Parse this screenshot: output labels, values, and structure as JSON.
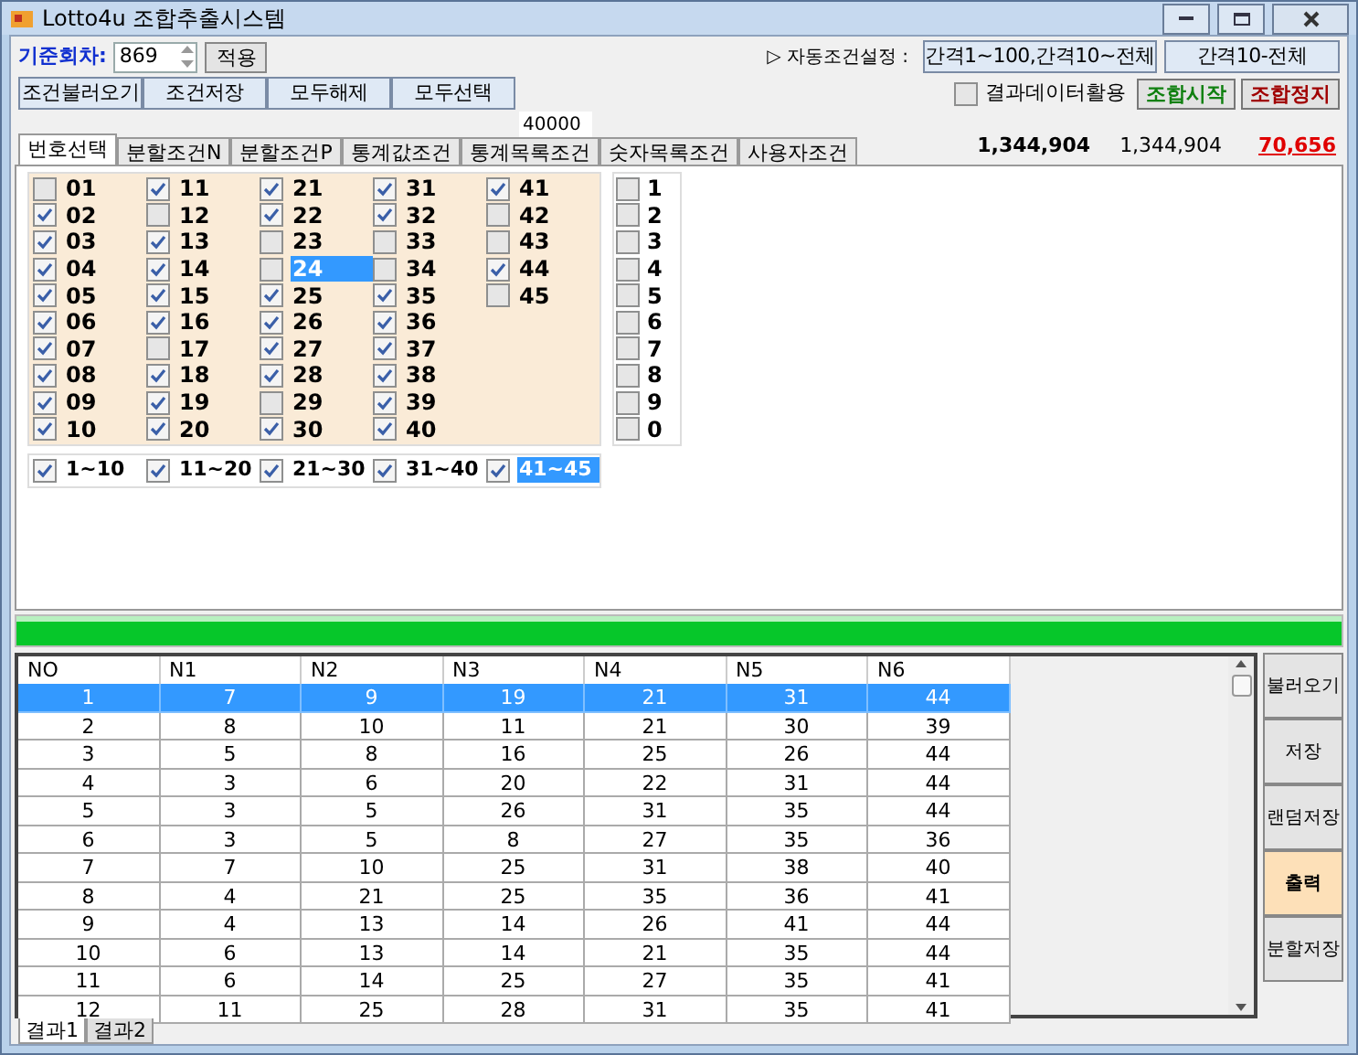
{
  "window": {
    "title": "Lotto4u 조합추출시스템"
  },
  "round": {
    "label": "기준회차:",
    "value": "869",
    "apply": "적용"
  },
  "auto": {
    "label": "▷ 자동조건설정 :",
    "buttons": [
      "간격1~100,간격10~전체",
      "간격10-전체"
    ]
  },
  "condition_buttons": [
    "조건불러오기",
    "조건저장",
    "모두해제",
    "모두선택"
  ],
  "use_result": {
    "label": "결과데이터활용",
    "checked": false
  },
  "start": "조합시작",
  "stop": "조합정지",
  "limit_field": {
    "value": "40000"
  },
  "tabs": [
    {
      "label": "번호선택",
      "selected": true
    },
    {
      "label": "분할조건N",
      "selected": false
    },
    {
      "label": "분할조건P",
      "selected": false
    },
    {
      "label": "통계값조건",
      "selected": false
    },
    {
      "label": "통계목록조건",
      "selected": false
    },
    {
      "label": "숫자목록조건",
      "selected": false
    },
    {
      "label": "사용자조건",
      "selected": false
    }
  ],
  "counts": {
    "total": "1,344,904",
    "current": "1,344,904",
    "excluded": "70,656"
  },
  "numbers": [
    {
      "label": "01",
      "checked": false,
      "highlighted": false
    },
    {
      "label": "02",
      "checked": true,
      "highlighted": false
    },
    {
      "label": "03",
      "checked": true,
      "highlighted": false
    },
    {
      "label": "04",
      "checked": true,
      "highlighted": false
    },
    {
      "label": "05",
      "checked": true,
      "highlighted": false
    },
    {
      "label": "06",
      "checked": true,
      "highlighted": false
    },
    {
      "label": "07",
      "checked": true,
      "highlighted": false
    },
    {
      "label": "08",
      "checked": true,
      "highlighted": false
    },
    {
      "label": "09",
      "checked": true,
      "highlighted": false
    },
    {
      "label": "10",
      "checked": true,
      "highlighted": false
    },
    {
      "label": "11",
      "checked": true,
      "highlighted": false
    },
    {
      "label": "12",
      "checked": false,
      "highlighted": false
    },
    {
      "label": "13",
      "checked": true,
      "highlighted": false
    },
    {
      "label": "14",
      "checked": true,
      "highlighted": false
    },
    {
      "label": "15",
      "checked": true,
      "highlighted": false
    },
    {
      "label": "16",
      "checked": true,
      "highlighted": false
    },
    {
      "label": "17",
      "checked": false,
      "highlighted": false
    },
    {
      "label": "18",
      "checked": true,
      "highlighted": false
    },
    {
      "label": "19",
      "checked": true,
      "highlighted": false
    },
    {
      "label": "20",
      "checked": true,
      "highlighted": false
    },
    {
      "label": "21",
      "checked": true,
      "highlighted": false
    },
    {
      "label": "22",
      "checked": true,
      "highlighted": false
    },
    {
      "label": "23",
      "checked": false,
      "highlighted": false
    },
    {
      "label": "24",
      "checked": false,
      "highlighted": true
    },
    {
      "label": "25",
      "checked": true,
      "highlighted": false
    },
    {
      "label": "26",
      "checked": true,
      "highlighted": false
    },
    {
      "label": "27",
      "checked": true,
      "highlighted": false
    },
    {
      "label": "28",
      "checked": true,
      "highlighted": false
    },
    {
      "label": "29",
      "checked": false,
      "highlighted": false
    },
    {
      "label": "30",
      "checked": true,
      "highlighted": false
    },
    {
      "label": "31",
      "checked": true,
      "highlighted": false
    },
    {
      "label": "32",
      "checked": true,
      "highlighted": false
    },
    {
      "label": "33",
      "checked": false,
      "highlighted": false
    },
    {
      "label": "34",
      "checked": false,
      "highlighted": false
    },
    {
      "label": "35",
      "checked": true,
      "highlighted": false
    },
    {
      "label": "36",
      "checked": true,
      "highlighted": false
    },
    {
      "label": "37",
      "checked": true,
      "highlighted": false
    },
    {
      "label": "38",
      "checked": true,
      "highlighted": false
    },
    {
      "label": "39",
      "checked": true,
      "highlighted": false
    },
    {
      "label": "40",
      "checked": true,
      "highlighted": false
    },
    {
      "label": "41",
      "checked": true,
      "highlighted": false
    },
    {
      "label": "42",
      "checked": false,
      "highlighted": false
    },
    {
      "label": "43",
      "checked": false,
      "highlighted": false
    },
    {
      "label": "44",
      "checked": true,
      "highlighted": false
    },
    {
      "label": "45",
      "checked": false,
      "highlighted": false
    }
  ],
  "digits": [
    {
      "label": "1",
      "checked": false
    },
    {
      "label": "2",
      "checked": false
    },
    {
      "label": "3",
      "checked": false
    },
    {
      "label": "4",
      "checked": false
    },
    {
      "label": "5",
      "checked": false
    },
    {
      "label": "6",
      "checked": false
    },
    {
      "label": "7",
      "checked": false
    },
    {
      "label": "8",
      "checked": false
    },
    {
      "label": "9",
      "checked": false
    },
    {
      "label": "0",
      "checked": false
    }
  ],
  "ranges": [
    {
      "label": "1~10",
      "checked": true,
      "highlighted": false
    },
    {
      "label": "11~20",
      "checked": true,
      "highlighted": false
    },
    {
      "label": "21~30",
      "checked": true,
      "highlighted": false
    },
    {
      "label": "31~40",
      "checked": true,
      "highlighted": false
    },
    {
      "label": "41~45",
      "checked": true,
      "highlighted": true
    }
  ],
  "progress": {
    "level": 1
  },
  "table": {
    "columns": [
      "NO",
      "N1",
      "N2",
      "N3",
      "N4",
      "N5",
      "N6"
    ],
    "rows": [
      {
        "selected": true,
        "cells": [
          "1",
          "7",
          "9",
          "19",
          "21",
          "31",
          "44"
        ]
      },
      {
        "selected": false,
        "cells": [
          "2",
          "8",
          "10",
          "11",
          "21",
          "30",
          "39"
        ]
      },
      {
        "selected": false,
        "cells": [
          "3",
          "5",
          "8",
          "16",
          "25",
          "26",
          "44"
        ]
      },
      {
        "selected": false,
        "cells": [
          "4",
          "3",
          "6",
          "20",
          "22",
          "31",
          "44"
        ]
      },
      {
        "selected": false,
        "cells": [
          "5",
          "3",
          "5",
          "26",
          "31",
          "35",
          "44"
        ]
      },
      {
        "selected": false,
        "cells": [
          "6",
          "3",
          "5",
          "8",
          "27",
          "35",
          "36"
        ]
      },
      {
        "selected": false,
        "cells": [
          "7",
          "7",
          "10",
          "25",
          "31",
          "38",
          "40"
        ]
      },
      {
        "selected": false,
        "cells": [
          "8",
          "4",
          "21",
          "25",
          "35",
          "36",
          "41"
        ]
      },
      {
        "selected": false,
        "cells": [
          "9",
          "4",
          "13",
          "14",
          "26",
          "41",
          "44"
        ]
      },
      {
        "selected": false,
        "cells": [
          "10",
          "6",
          "13",
          "14",
          "21",
          "35",
          "44"
        ]
      },
      {
        "selected": false,
        "cells": [
          "11",
          "6",
          "14",
          "25",
          "27",
          "35",
          "41"
        ]
      },
      {
        "selected": false,
        "cells": [
          "12",
          "11",
          "25",
          "28",
          "31",
          "35",
          "41"
        ]
      }
    ]
  },
  "side_buttons": [
    {
      "label": "불러오기",
      "selected": false
    },
    {
      "label": "저장",
      "selected": false
    },
    {
      "label": "랜덤저장",
      "selected": false
    },
    {
      "label": "출력",
      "selected": true
    },
    {
      "label": "분할저장",
      "selected": false
    }
  ],
  "result_tabs": [
    {
      "label": "결과1",
      "selected": true
    },
    {
      "label": "결과2",
      "selected": false
    }
  ]
}
